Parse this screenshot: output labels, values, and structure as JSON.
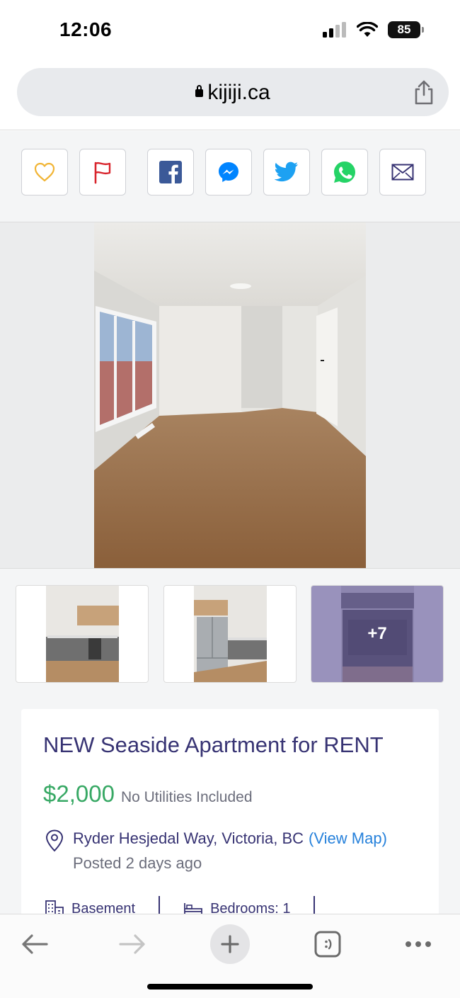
{
  "status_bar": {
    "time": "12:06",
    "battery": "85"
  },
  "browser": {
    "url": "kijiji.ca"
  },
  "actions": [
    {
      "name": "favourite-button",
      "icon": "heart-icon"
    },
    {
      "name": "report-button",
      "icon": "flag-icon"
    },
    {
      "name": "share-facebook-button",
      "icon": "facebook-icon"
    },
    {
      "name": "share-messenger-button",
      "icon": "messenger-icon"
    },
    {
      "name": "share-twitter-button",
      "icon": "twitter-icon"
    },
    {
      "name": "share-whatsapp-button",
      "icon": "whatsapp-icon"
    },
    {
      "name": "share-email-button",
      "icon": "mail-icon"
    }
  ],
  "gallery": {
    "more_label": "+7"
  },
  "listing": {
    "title": "NEW Seaside Apartment for RENT",
    "price": "$2,000",
    "utilities": "No Utilities Included",
    "address": "Ryder Hesjedal Way, Victoria, BC",
    "view_map": "(View Map)",
    "posted": "Posted 2 days ago",
    "attributes": {
      "unit_type": "Basement",
      "bedrooms": "Bedrooms: 1"
    }
  },
  "colors": {
    "accent_blue": "#2681db",
    "price_green": "#37a864",
    "heart": "#f1b434",
    "flag": "#d8242c",
    "facebook": "#3b5998",
    "messenger": "#0084ff",
    "twitter": "#1da1f2",
    "whatsapp": "#25d366"
  }
}
